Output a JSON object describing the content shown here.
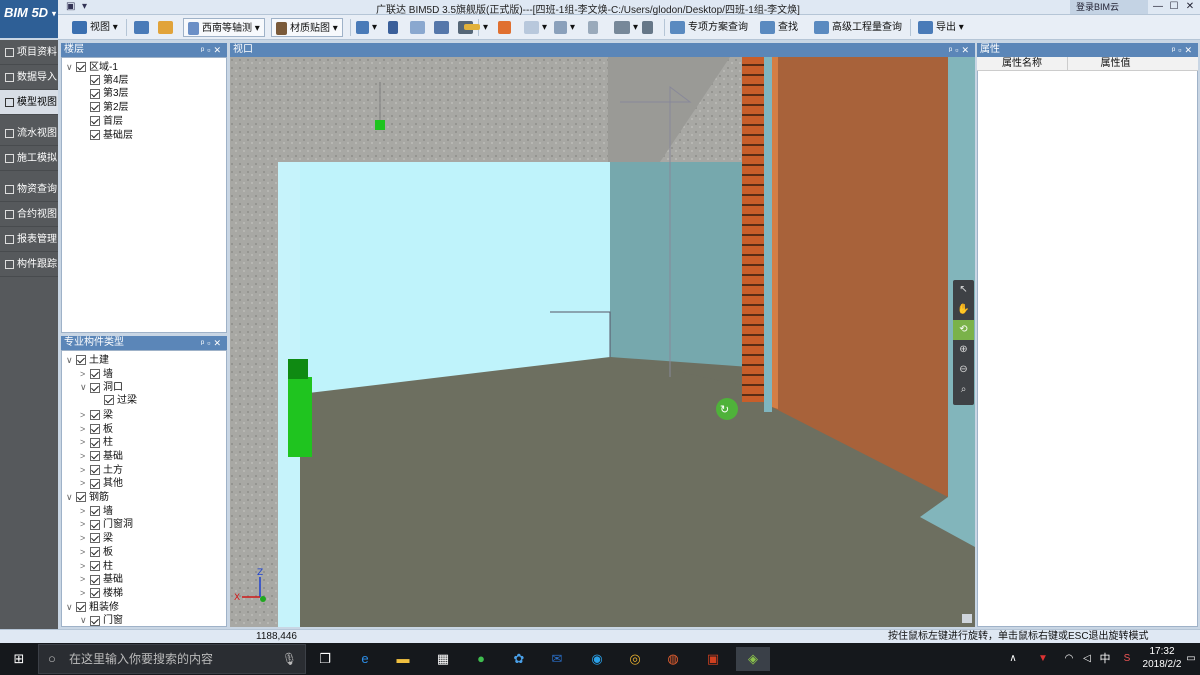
{
  "app": {
    "logo": "BIM 5D",
    "title": "广联达 BIM5D 3.5旗舰版(正式版)---[四班-1组-李文焕-C:/Users/glodon/Desktop/四班-1组-李文焕]",
    "cloud_login": "登录BIM云"
  },
  "toolbar": {
    "view": "视图",
    "axis_view": "西南等轴测",
    "material": "材质贴图",
    "special_plan": "专项方案查询",
    "find": "查找",
    "advanced_qty": "高级工程量查询",
    "export": "导出"
  },
  "leftnav": [
    {
      "label": "项目资料",
      "icon": "folder-icon"
    },
    {
      "label": "数据导入",
      "icon": "import-icon"
    },
    {
      "label": "模型视图",
      "icon": "model-icon",
      "active": true
    },
    {
      "label": "流水视图",
      "icon": "flow-icon"
    },
    {
      "label": "施工模拟",
      "icon": "simulation-icon"
    },
    {
      "label": "物资查询",
      "icon": "material-icon"
    },
    {
      "label": "合约视图",
      "icon": "contract-icon"
    },
    {
      "label": "报表管理",
      "icon": "report-icon"
    },
    {
      "label": "构件跟踪",
      "icon": "track-icon"
    }
  ],
  "floors": {
    "title": "楼层",
    "items": [
      {
        "label": "区域-1",
        "level": 0,
        "expand": "∨"
      },
      {
        "label": "第4层",
        "level": 1
      },
      {
        "label": "第3层",
        "level": 1
      },
      {
        "label": "第2层",
        "level": 1
      },
      {
        "label": "首层",
        "level": 1
      },
      {
        "label": "基础层",
        "level": 1
      }
    ]
  },
  "types": {
    "title": "专业构件类型",
    "items": [
      {
        "label": "土建",
        "level": 0,
        "expand": "∨"
      },
      {
        "label": "墙",
        "level": 1,
        "expand": ">"
      },
      {
        "label": "洞口",
        "level": 1,
        "expand": "∨"
      },
      {
        "label": "过梁",
        "level": 2
      },
      {
        "label": "梁",
        "level": 1,
        "expand": ">"
      },
      {
        "label": "板",
        "level": 1,
        "expand": ">"
      },
      {
        "label": "柱",
        "level": 1,
        "expand": ">"
      },
      {
        "label": "基础",
        "level": 1,
        "expand": ">"
      },
      {
        "label": "土方",
        "level": 1,
        "expand": ">"
      },
      {
        "label": "其他",
        "level": 1,
        "expand": ">"
      },
      {
        "label": "钢筋",
        "level": 0,
        "expand": "∨"
      },
      {
        "label": "墙",
        "level": 1,
        "expand": ">"
      },
      {
        "label": "门窗洞",
        "level": 1,
        "expand": ">"
      },
      {
        "label": "梁",
        "level": 1,
        "expand": ">"
      },
      {
        "label": "板",
        "level": 1,
        "expand": ">"
      },
      {
        "label": "柱",
        "level": 1,
        "expand": ">"
      },
      {
        "label": "基础",
        "level": 1,
        "expand": ">"
      },
      {
        "label": "楼梯",
        "level": 1,
        "expand": ">"
      },
      {
        "label": "粗装修",
        "level": 0,
        "expand": "∨"
      },
      {
        "label": "门窗",
        "level": 1,
        "expand": "∨"
      }
    ]
  },
  "viewport": {
    "title": "视口",
    "axis_z": "Z",
    "axis_x": "X"
  },
  "properties": {
    "title": "属性",
    "col_name": "属性名称",
    "col_value": "属性值"
  },
  "status": {
    "coords": "1188,446",
    "hint": "按住鼠标左键进行旋转，单击鼠标右键或ESC退出旋转模式"
  },
  "taskbar": {
    "search_placeholder": "在这里输入你要搜索的内容",
    "ime": "中",
    "time": "17:32",
    "date": "2018/2/2"
  },
  "colors": {
    "accent": "#5b86b8",
    "nav_bg": "#56595c",
    "selection_green": "#1fc41f"
  }
}
